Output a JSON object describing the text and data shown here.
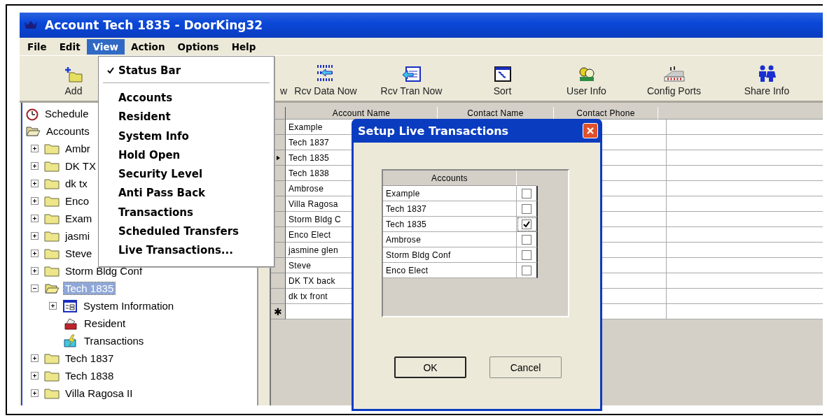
{
  "window": {
    "title": "Account Tech 1835 - DoorKing32"
  },
  "menu_bar": [
    {
      "label": "File",
      "selected": false
    },
    {
      "label": "Edit",
      "selected": false
    },
    {
      "label": "View",
      "selected": true
    },
    {
      "label": "Action",
      "selected": false
    },
    {
      "label": "Options",
      "selected": false
    },
    {
      "label": "Help",
      "selected": false
    }
  ],
  "view_menu": [
    {
      "kind": "item",
      "label": "Status Bar",
      "checked": true
    },
    {
      "kind": "separator"
    },
    {
      "kind": "item",
      "label": "Accounts",
      "checked": false
    },
    {
      "kind": "item",
      "label": "Resident",
      "checked": false
    },
    {
      "kind": "item",
      "label": "System Info",
      "checked": false
    },
    {
      "kind": "item",
      "label": "Hold Open",
      "checked": false
    },
    {
      "kind": "item",
      "label": "Security Level",
      "checked": false
    },
    {
      "kind": "item",
      "label": "Anti Pass Back",
      "checked": false
    },
    {
      "kind": "item",
      "label": "Transactions",
      "checked": false
    },
    {
      "kind": "item",
      "label": "Scheduled Transfers",
      "checked": false
    },
    {
      "kind": "item",
      "label": "Live Transactions...",
      "checked": false
    }
  ],
  "toolbar": [
    {
      "label": "Add"
    },
    {
      "label": "w"
    },
    {
      "label": "Rcv Data Now"
    },
    {
      "label": "Rcv Tran Now"
    },
    {
      "label": "Sort"
    },
    {
      "label": "User Info"
    },
    {
      "label": "Config Ports"
    },
    {
      "label": "Share Info"
    }
  ],
  "tree": [
    {
      "kind": "schedule",
      "label": "Schedule",
      "selected": false
    },
    {
      "kind": "root",
      "label": "Accounts",
      "selected": false,
      "children": [
        {
          "kind": "folder",
          "label": "Ambr",
          "selected": false,
          "expanded": false
        },
        {
          "kind": "folder",
          "label": "DK TX",
          "selected": false,
          "expanded": false
        },
        {
          "kind": "folder",
          "label": "dk tx",
          "selected": false,
          "expanded": false
        },
        {
          "kind": "folder",
          "label": "Enco",
          "selected": false,
          "expanded": false
        },
        {
          "kind": "folder",
          "label": "Exam",
          "selected": false,
          "expanded": false
        },
        {
          "kind": "folder",
          "label": "jasmi",
          "selected": false,
          "expanded": false
        },
        {
          "kind": "folder",
          "label": "Steve",
          "selected": false,
          "expanded": false
        },
        {
          "kind": "folder",
          "label": "Storm Bldg Conf",
          "selected": false,
          "expanded": false
        },
        {
          "kind": "folder",
          "label": "Tech 1835",
          "selected": true,
          "expanded": true,
          "children": [
            {
              "kind": "info",
              "label": "System Information",
              "selected": false,
              "expanded": false
            },
            {
              "kind": "resident",
              "label": "Resident",
              "selected": false
            },
            {
              "kind": "transactions",
              "label": "Transactions",
              "selected": false
            }
          ]
        },
        {
          "kind": "folder",
          "label": "Tech 1837",
          "selected": false,
          "expanded": false
        },
        {
          "kind": "folder",
          "label": "Tech 1838",
          "selected": false,
          "expanded": false
        },
        {
          "kind": "folder",
          "label": "Villa Ragosa II",
          "selected": false,
          "expanded": false
        }
      ]
    }
  ],
  "table": {
    "columns": [
      "Account Name",
      "Contact Name",
      "Contact Phone"
    ],
    "rows": [
      {
        "account_name": "Example",
        "selected": false
      },
      {
        "account_name": "Tech 1837",
        "selected": false
      },
      {
        "account_name": "Tech 1835",
        "selected": true
      },
      {
        "account_name": "Tech 1838",
        "selected": false
      },
      {
        "account_name": "Ambrose",
        "selected": false
      },
      {
        "account_name": "Villa Ragosa",
        "selected": false
      },
      {
        "account_name": "Storm Bldg C",
        "selected": false
      },
      {
        "account_name": "Enco Elect",
        "selected": false
      },
      {
        "account_name": "jasmine glen",
        "selected": false
      },
      {
        "account_name": "Steve",
        "selected": false
      },
      {
        "account_name": "DK TX back",
        "selected": false
      },
      {
        "account_name": "dk tx front",
        "selected": false
      }
    ],
    "new_row_marker": "✱"
  },
  "dialog": {
    "title": "Setup Live Transactions",
    "column": "Accounts",
    "accounts": [
      {
        "label": "Example",
        "checked": false
      },
      {
        "label": "Tech 1837",
        "checked": false
      },
      {
        "label": "Tech 1835",
        "checked": true
      },
      {
        "label": "Ambrose",
        "checked": false
      },
      {
        "label": "Storm Bldg Conf",
        "checked": false
      },
      {
        "label": "Enco Elect",
        "checked": false
      }
    ],
    "buttons": [
      {
        "label": "OK"
      },
      {
        "label": "Cancel"
      }
    ]
  }
}
